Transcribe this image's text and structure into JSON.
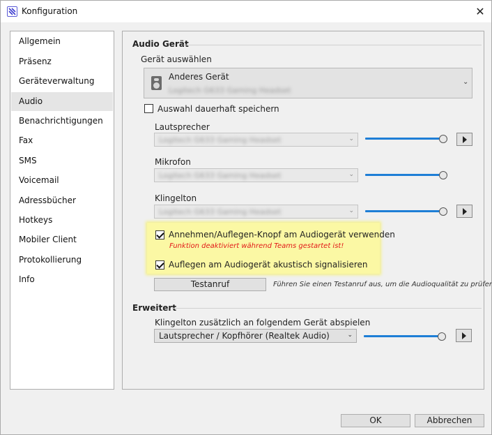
{
  "window": {
    "title": "Konfiguration",
    "close_glyph": "✕"
  },
  "sidebar": {
    "items": [
      {
        "label": "Allgemein"
      },
      {
        "label": "Präsenz"
      },
      {
        "label": "Geräteverwaltung"
      },
      {
        "label": "Audio",
        "selected": true
      },
      {
        "label": "Benachrichtigungen"
      },
      {
        "label": "Fax"
      },
      {
        "label": "SMS"
      },
      {
        "label": "Voicemail"
      },
      {
        "label": "Adressbücher"
      },
      {
        "label": "Hotkeys"
      },
      {
        "label": "Mobiler Client"
      },
      {
        "label": "Protokollierung"
      },
      {
        "label": "Info"
      }
    ]
  },
  "audio": {
    "section_title": "Audio Gerät",
    "device_select_label": "Gerät auswählen",
    "device_name": "Anderes Gerät",
    "device_sub": "Logitech G633 Gaming Headset",
    "save_selection_label": "Auswahl dauerhaft speichern",
    "save_selection_checked": false,
    "speaker": {
      "label": "Lautsprecher",
      "value": "Logitech G633 Gaming Headset",
      "level": 0.98
    },
    "microphone": {
      "label": "Mikrofon",
      "value": "Logitech G633 Gaming Headset",
      "level": 0.98
    },
    "ringtone": {
      "label": "Klingelton",
      "value": "Logitech G633 Gaming Headset",
      "level": 0.98
    },
    "answer_button_label": "Annehmen/Auflegen-Knopf am Audiogerät verwenden",
    "answer_button_checked": true,
    "answer_button_warning": "Funktion deaktiviert während Teams gestartet ist!",
    "hangup_signal_label": "Auflegen am Audiogerät akustisch signalisieren",
    "hangup_signal_checked": true,
    "test_call_label": "Testanruf",
    "test_call_hint": "Führen Sie einen Testanruf aus, um die Audioqualität zu prüfen."
  },
  "advanced": {
    "section_title": "Erweitert",
    "extra_ring_label": "Klingelton zusätzlich an folgendem Gerät abspielen",
    "extra_ring_value": "Lautsprecher / Kopfhörer (Realtek Audio)",
    "extra_ring_level": 0.98
  },
  "footer": {
    "ok_label": "OK",
    "cancel_label": "Abbrechen"
  },
  "icons": {
    "app": "app-logo-icon",
    "close": "close-icon",
    "device": "speaker-device-icon",
    "play": "play-icon",
    "dropdown": "chevron-down-icon"
  },
  "colors": {
    "slider": "#1e7ed6",
    "highlight": "#fbf8a4",
    "warning": "#e21818"
  }
}
